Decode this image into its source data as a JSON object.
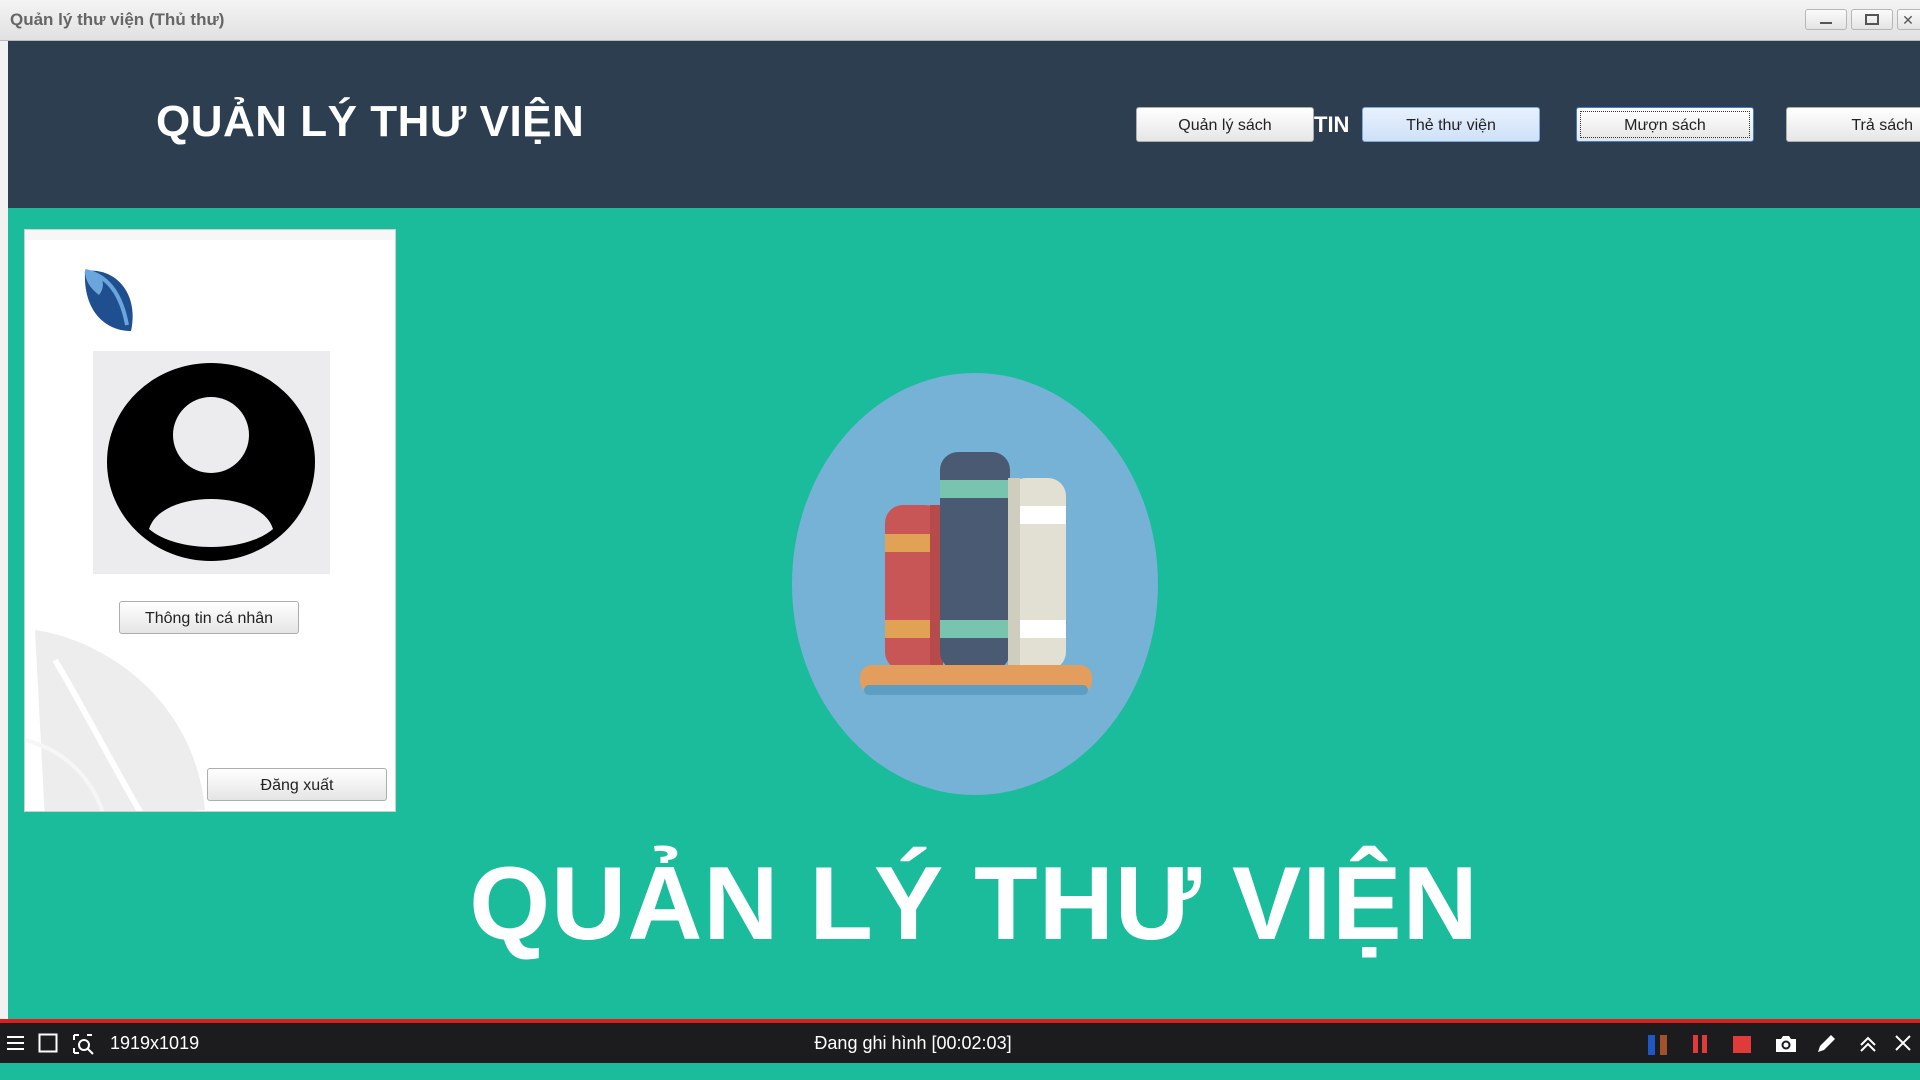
{
  "window": {
    "title": "Quản lý thư viện (Thủ thư)"
  },
  "header": {
    "title": "QUẢN LÝ THƯ VIỆN",
    "fragment_text": "TIN",
    "nav": {
      "books_label": "Quản lý sách",
      "library_card_label": "Thẻ thư viện",
      "borrow_label": "Mượn sách",
      "return_label": "Trả sách"
    }
  },
  "sidebar": {
    "profile_button_label": "Thông tin cá nhân",
    "logout_button_label": "Đăng xuất"
  },
  "main": {
    "hero_title": "QUẢN LÝ THƯ VIỆN"
  },
  "recorder": {
    "resolution": "1919x1019",
    "status": "Đang ghi hình [00:02:03]"
  },
  "colors": {
    "header_bg": "#2c3e50",
    "main_bg": "#1bbc9b",
    "accent_red": "#e01b1b"
  },
  "icons": [
    "leaf-logo-icon",
    "user-avatar-icon",
    "books-illustration-icon",
    "menu-icon",
    "square-icon",
    "zoom-icon",
    "pause-icon",
    "stop-icon",
    "camera-icon",
    "pen-icon",
    "chevron-up-icon",
    "close-icon"
  ]
}
